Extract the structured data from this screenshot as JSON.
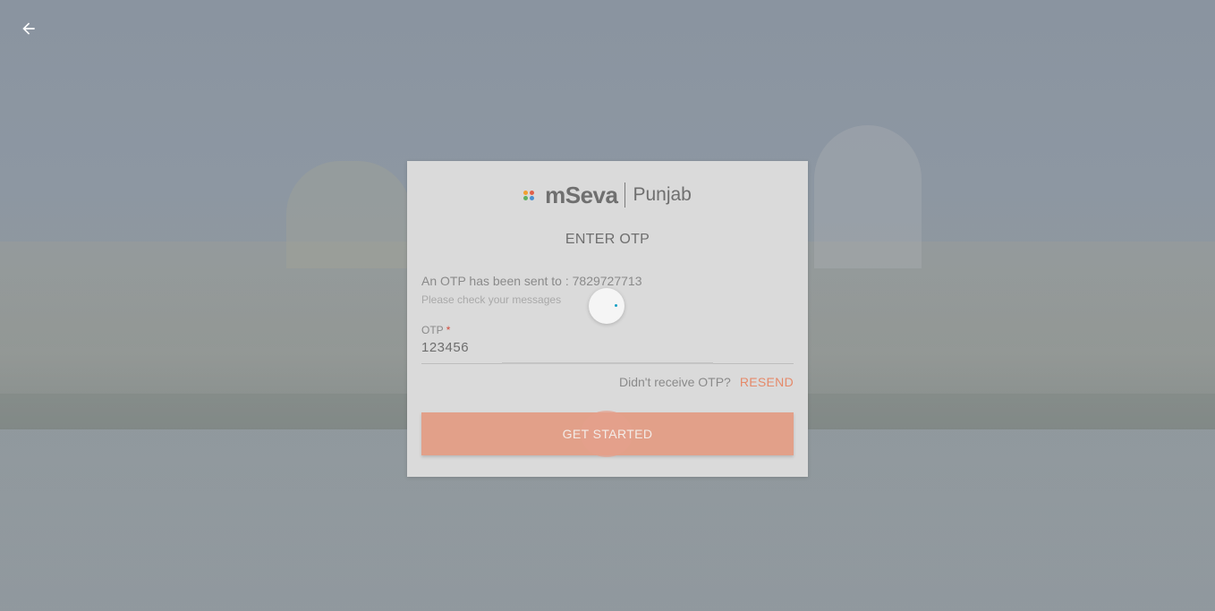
{
  "header": {
    "back_icon": "arrow-left-icon"
  },
  "brand": {
    "name": "mSeva",
    "state": "Punjab",
    "dot_colors": [
      "#f0a030",
      "#e0604a",
      "#4a90d0",
      "#60b060",
      "#4a90d0",
      "#f0a030"
    ]
  },
  "otp_form": {
    "title": "ENTER OTP",
    "sent_prefix": "An OTP has been sent to :",
    "phone": "7829727713",
    "hint": "Please check your messages",
    "field_label": "OTP",
    "required_mark": "*",
    "value": "123456",
    "resend_question": "Didn't receive OTP?",
    "resend_label": "RESEND",
    "submit_label": "GET STARTED"
  },
  "colors": {
    "accent": "#e58a6a",
    "button_bg": "#e2a089",
    "spinner": "#16a0c4"
  }
}
